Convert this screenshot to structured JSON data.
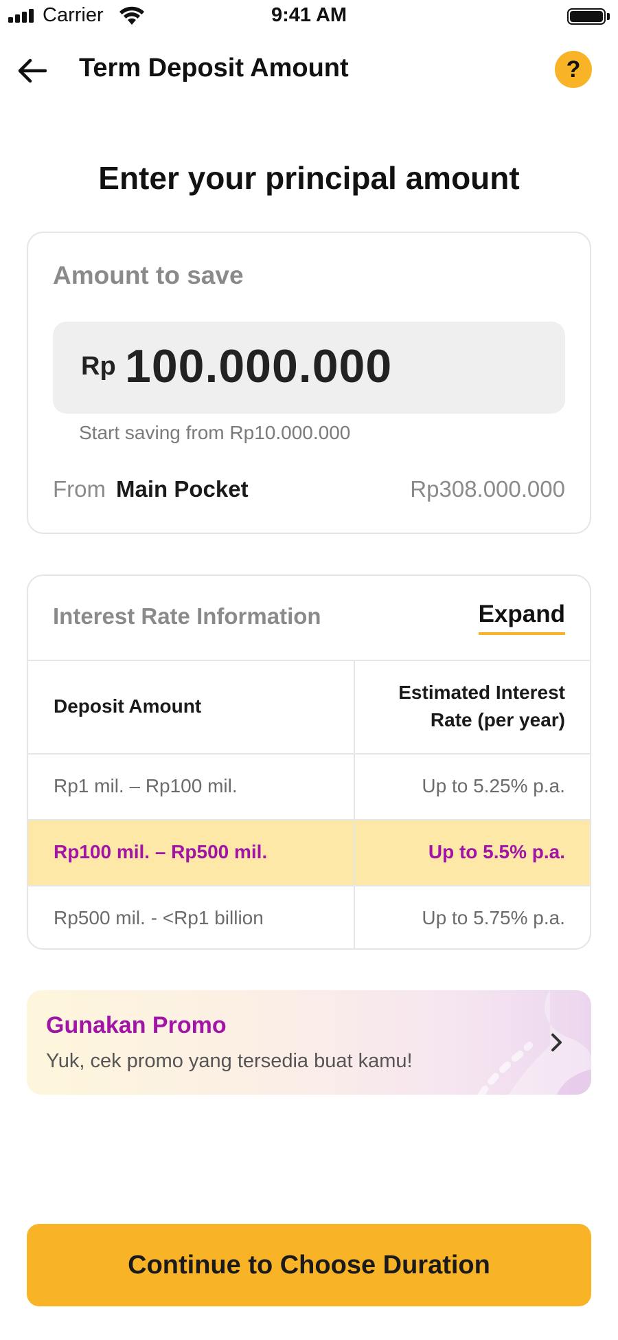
{
  "status_bar": {
    "carrier": "Carrier",
    "time": "9:41 AM"
  },
  "header": {
    "title": "Term Deposit Amount",
    "help_icon": "?"
  },
  "heading": "Enter your principal amount",
  "amount_card": {
    "label": "Amount to save",
    "currency": "Rp",
    "value": "100.000.000",
    "min_hint": "Start saving from Rp10.000.000",
    "from_label": "From",
    "pocket_name": "Main Pocket",
    "pocket_balance": "Rp308.000.000"
  },
  "interest_info": {
    "title": "Interest Rate Information",
    "expand_label": "Expand",
    "headers": {
      "amount": "Deposit Amount",
      "rate_line1": "Estimated Interest",
      "rate_line2": "Rate (per year)"
    },
    "rows": [
      {
        "amount": "Rp1 mil. – Rp100 mil.",
        "rate": "Up to 5.25% p.a.",
        "highlighted": false
      },
      {
        "amount": "Rp100 mil. – Rp500 mil.",
        "rate": "Up to 5.5% p.a.",
        "highlighted": true
      },
      {
        "amount": "Rp500 mil. - <Rp1 billion",
        "rate": "Up to 5.75% p.a.",
        "highlighted": false
      }
    ]
  },
  "promo": {
    "title": "Gunakan Promo",
    "subtitle": "Yuk, cek promo yang tersedia buat kamu!"
  },
  "cta": {
    "label": "Continue to Choose Duration"
  },
  "colors": {
    "accent": "#f9b327",
    "promo_purple": "#a114a6",
    "highlight_row": "#fde8a8"
  }
}
